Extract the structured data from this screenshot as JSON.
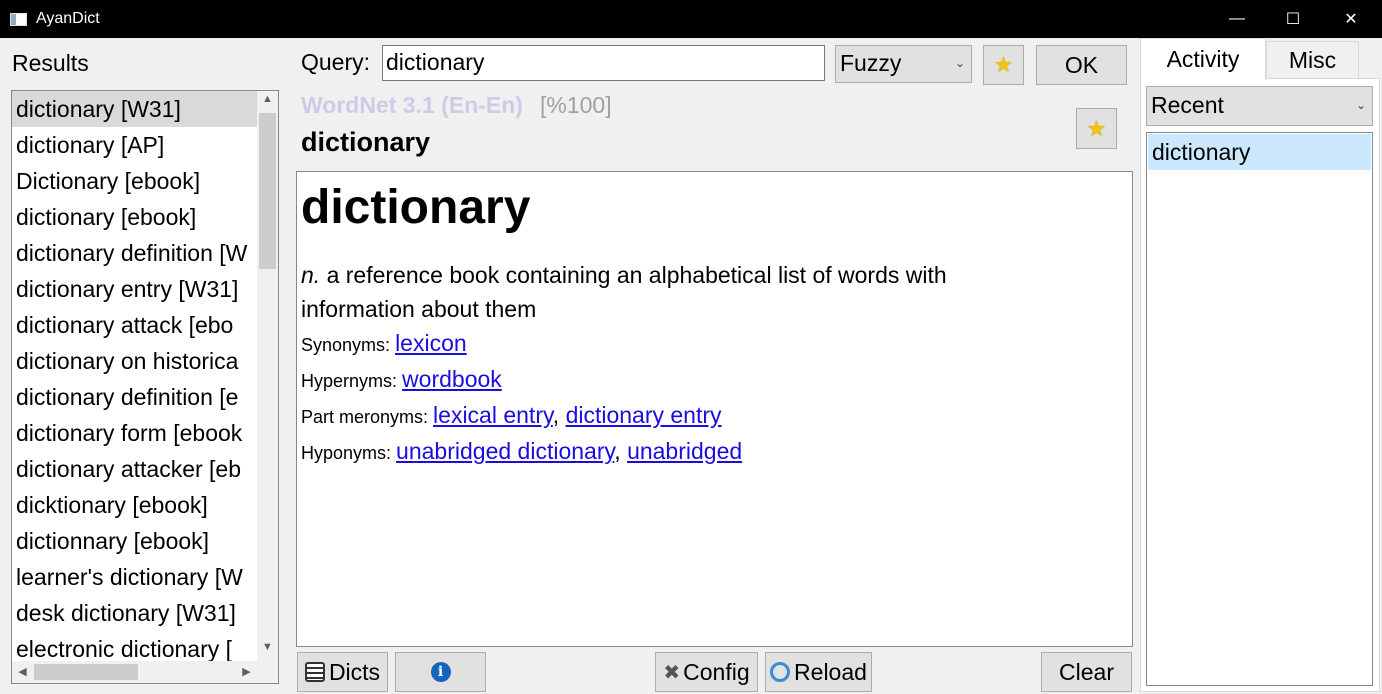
{
  "window": {
    "title": "AyanDict",
    "minimize": "—",
    "maximize": "☐",
    "close": "✕"
  },
  "results": {
    "label": "Results",
    "items": [
      "dictionary [W31]",
      "dictionary [AP]",
      "Dictionary [ebook]",
      "dictionary [ebook]",
      "dictionary definition [W",
      "dictionary entry [W31]",
      "dictionary attack [ebo",
      "dictionary on historica",
      "dictionary definition [e",
      "dictionary form [ebook",
      "dictionary attacker [eb",
      "dicktionary [ebook]",
      "dictionnary [ebook]",
      "learner's dictionary [W",
      "desk dictionary [W31]",
      "electronic dictionary ["
    ],
    "selected_index": 0
  },
  "query": {
    "label": "Query:",
    "value": "dictionary",
    "mode": "Fuzzy",
    "ok_label": "OK"
  },
  "entry": {
    "dict_name": "WordNet 3.1 (En-En)",
    "score": "[%100]",
    "headword": "dictionary",
    "word": "dictionary",
    "pos": "n.",
    "definition": "a reference book containing an alphabetical list of words with information about them",
    "relations": [
      {
        "label": "Synonyms:",
        "links": [
          "lexicon"
        ]
      },
      {
        "label": "Hypernyms:",
        "links": [
          "wordbook"
        ]
      },
      {
        "label": "Part meronyms:",
        "links": [
          "lexical entry",
          "dictionary entry"
        ]
      },
      {
        "label": "Hyponyms:",
        "links": [
          "unabridged dictionary",
          "unabridged"
        ]
      }
    ]
  },
  "bottom": {
    "dicts_label": "Dicts",
    "config_label": "Config",
    "reload_label": "Reload",
    "clear_label": "Clear",
    "info_glyph": "i"
  },
  "side": {
    "tabs": [
      "Activity",
      "Misc"
    ],
    "active_tab": "Activity",
    "recent_select": "Recent",
    "recent_items": [
      "dictionary"
    ]
  },
  "icons": {
    "star": "star-icon",
    "info": "info-icon",
    "list": "list-icon",
    "tools": "tools-icon",
    "reload": "reload-icon"
  }
}
